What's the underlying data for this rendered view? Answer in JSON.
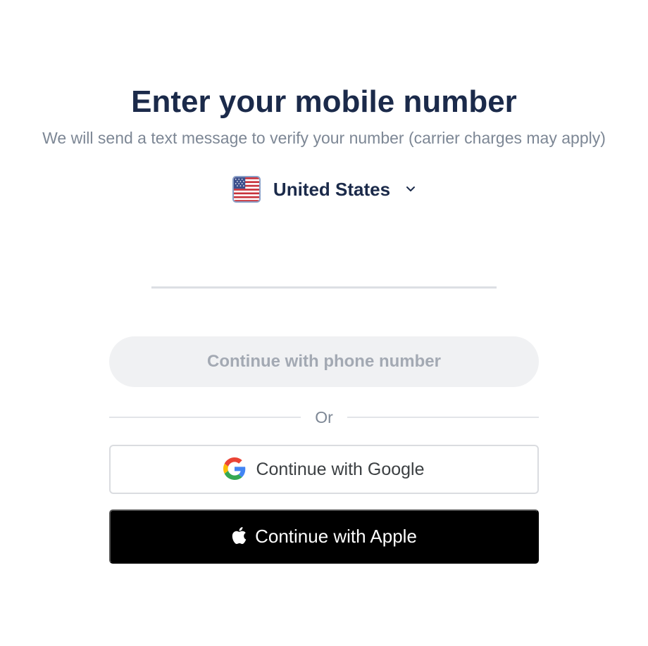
{
  "header": {
    "title": "Enter your mobile number",
    "subtitle": "We will send a text message to verify your number (carrier charges may apply)"
  },
  "country_selector": {
    "flag_icon": "us-flag-icon",
    "country": "United States",
    "chevron_icon": "chevron-down-icon"
  },
  "phone_input": {
    "value": "",
    "placeholder": ""
  },
  "buttons": {
    "phone": "Continue with phone number",
    "divider": "Or",
    "google": "Continue with Google",
    "google_icon": "google-icon",
    "apple": "Continue with Apple",
    "apple_icon": "apple-icon"
  },
  "colors": {
    "title": "#1b2a4a",
    "muted_text": "#7d8795",
    "disabled_button_bg": "#f0f1f3",
    "disabled_button_text": "#a3a9b3",
    "apple_button_bg": "#000000"
  }
}
